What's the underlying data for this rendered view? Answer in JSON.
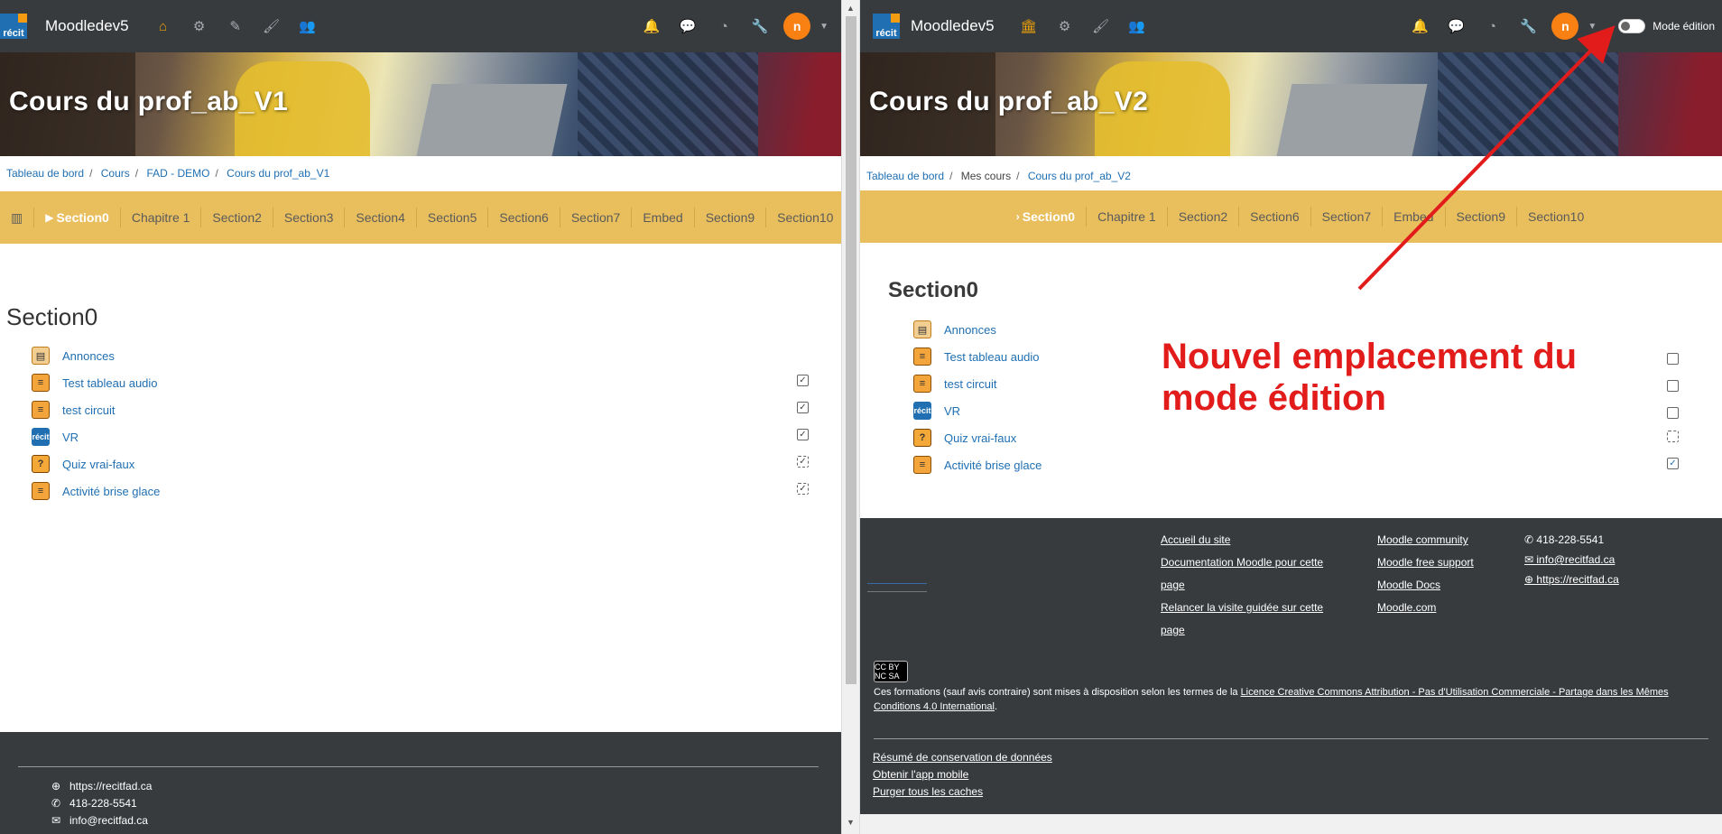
{
  "colors": {
    "navbar": "#373b3e",
    "section_bar": "#e9bf5e",
    "link": "#1f6fb2",
    "accent": "#f98012",
    "annotation": "#e21b1b"
  },
  "left": {
    "brand": "Moodledev5",
    "logo_text": "récit",
    "course_title": "Cours du prof_ab_V1",
    "breadcrumb": [
      "Tableau de bord",
      "Cours",
      "FAD - DEMO",
      "Cours du prof_ab_V1"
    ],
    "tabs": [
      "Section0",
      "Chapitre 1",
      "Section2",
      "Section3",
      "Section4",
      "Section5",
      "Section6",
      "Section7",
      "Embed",
      "Section9",
      "Section10"
    ],
    "section_title": "Section0",
    "activities": [
      {
        "label": "Annonces",
        "icon": "forum-icon"
      },
      {
        "label": "Test tableau audio",
        "icon": "page-icon"
      },
      {
        "label": "test circuit",
        "icon": "page-icon"
      },
      {
        "label": "VR",
        "icon": "vr-icon"
      },
      {
        "label": "Quiz vrai-faux",
        "icon": "quiz-icon"
      },
      {
        "label": "Activité brise glace",
        "icon": "page-icon"
      }
    ],
    "footer": {
      "website": "https://recitfad.ca",
      "phone": "418-228-5541",
      "email": "info@recitfad.ca"
    },
    "avatar_text": "n"
  },
  "right": {
    "brand": "Moodledev5",
    "logo_text": "récit",
    "course_title": "Cours du prof_ab_V2",
    "breadcrumb": [
      "Tableau de bord",
      "Mes cours",
      "Cours du prof_ab_V2"
    ],
    "tabs": [
      "Section0",
      "Chapitre 1",
      "Section2",
      "Section6",
      "Section7",
      "Embed",
      "Section9",
      "Section10"
    ],
    "section_title": "Section0",
    "edit_mode_label": "Mode édition",
    "activities": [
      {
        "label": "Annonces",
        "icon": "forum-icon"
      },
      {
        "label": "Test tableau audio",
        "icon": "page-icon"
      },
      {
        "label": "test circuit",
        "icon": "page-icon"
      },
      {
        "label": "VR",
        "icon": "vr-icon"
      },
      {
        "label": "Quiz vrai-faux",
        "icon": "quiz-icon"
      },
      {
        "label": "Activité brise glace",
        "icon": "page-icon"
      }
    ],
    "footer": {
      "col1": [
        "Accueil du site",
        "Documentation Moodle pour cette",
        "page",
        "Relancer la visite guidée sur cette",
        "page"
      ],
      "col2": [
        "Moodle community",
        "Moodle free support",
        "Moodle Docs",
        "Moodle.com"
      ],
      "col3": [
        "418-228-5541",
        "info@recitfad.ca",
        "https://recitfad.ca"
      ],
      "cc_badge": "CC BY NC SA",
      "license_prefix": "Ces formations (sauf avis contraire) sont mises à disposition selon les termes de la ",
      "license_link": "Licence Creative Commons Attribution - Pas d'Utilisation Commerciale - Partage dans les Mêmes Conditions 4.0 International",
      "license_suffix": ".",
      "bottom_links": [
        "Résumé de conservation de données",
        "Obtenir l'app mobile",
        "Purger tous les caches"
      ]
    },
    "avatar_text": "n"
  },
  "annotation": {
    "line1": "Nouvel emplacement du",
    "line2": "mode édition"
  }
}
